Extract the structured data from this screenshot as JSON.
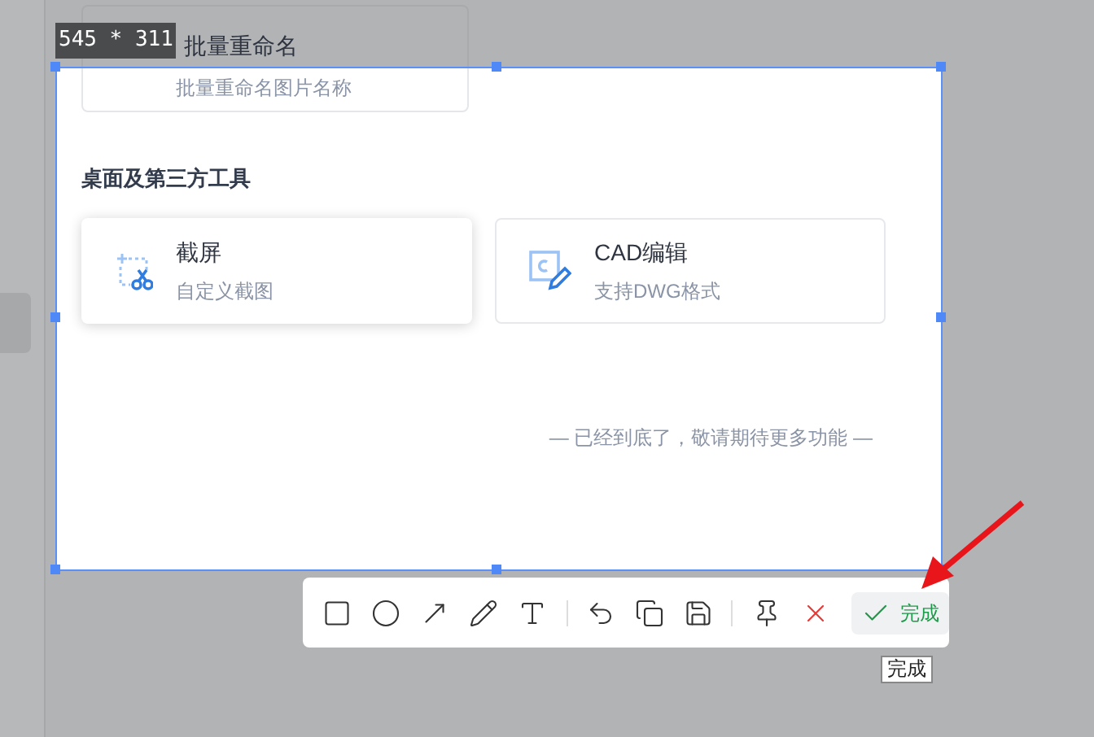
{
  "size_label": "545 * 311",
  "background_card": {
    "title": "批量重命名",
    "subtitle": "批量重命名图片名称"
  },
  "section_title": "桌面及第三方工具",
  "tools": [
    {
      "kind": "screenshot",
      "title": "截屏",
      "subtitle": "自定义截图",
      "hovered": true
    },
    {
      "kind": "cad",
      "title": "CAD编辑",
      "subtitle": "支持DWG格式",
      "hovered": false
    }
  ],
  "end_note": "— 已经到底了，敬请期待更多功能 —",
  "toolbar": {
    "items": [
      {
        "kind": "rectangle"
      },
      {
        "kind": "ellipse"
      },
      {
        "kind": "arrow"
      },
      {
        "kind": "pencil"
      },
      {
        "kind": "text"
      },
      {
        "kind": "divider"
      },
      {
        "kind": "undo"
      },
      {
        "kind": "copy"
      },
      {
        "kind": "save"
      },
      {
        "kind": "divider"
      },
      {
        "kind": "pin"
      },
      {
        "kind": "cancel"
      }
    ],
    "done_label": "完成"
  },
  "tooltip": "完成"
}
